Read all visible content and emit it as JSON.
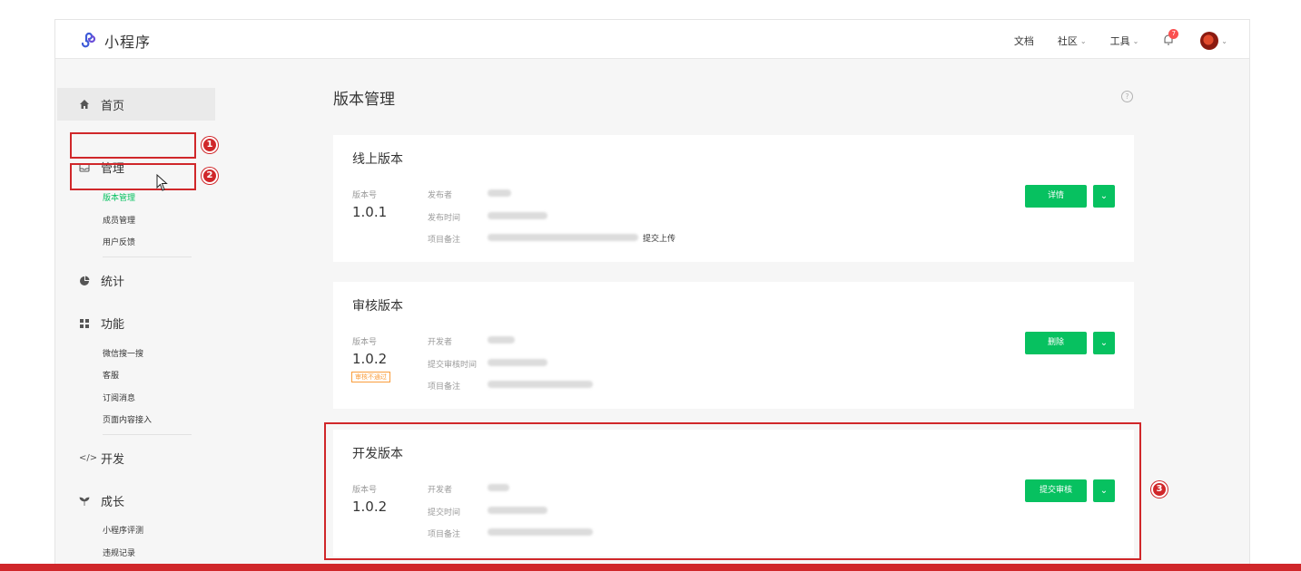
{
  "app": {
    "title": "小程序"
  },
  "topnav": {
    "docs": "文档",
    "community": "社区",
    "tools": "工具",
    "notification_count": "7"
  },
  "sidebar": {
    "home": "首页",
    "manage": "管理",
    "manage_items": [
      "版本管理",
      "成员管理",
      "用户反馈"
    ],
    "stats": "统计",
    "features": "功能",
    "feature_items": [
      "微信搜一搜",
      "客服",
      "订阅消息",
      "页面内容接入"
    ],
    "dev": "开发",
    "growth": "成长",
    "growth_items": [
      "小程序评测",
      "违规记录"
    ]
  },
  "page": {
    "title": "版本管理",
    "help": "?"
  },
  "online": {
    "title": "线上版本",
    "version_label": "版本号",
    "version": "1.0.1",
    "meta_labels": [
      "发布者",
      "发布时间",
      "项目备注"
    ],
    "remark_suffix": "提交上传",
    "primary": "详情"
  },
  "review": {
    "title": "审核版本",
    "version_label": "版本号",
    "version": "1.0.2",
    "status": "审核不通过",
    "meta_labels": [
      "开发者",
      "提交审核时间",
      "项目备注"
    ],
    "primary": "删除"
  },
  "dev_version": {
    "title": "开发版本",
    "version_label": "版本号",
    "version": "1.0.2",
    "meta_labels": [
      "开发者",
      "提交时间",
      "项目备注"
    ],
    "primary": "提交审核"
  },
  "annotations": [
    "1",
    "2",
    "3"
  ],
  "colors": {
    "accent": "#07c160",
    "highlight": "#d0272a",
    "warning": "#fa9d3b"
  }
}
